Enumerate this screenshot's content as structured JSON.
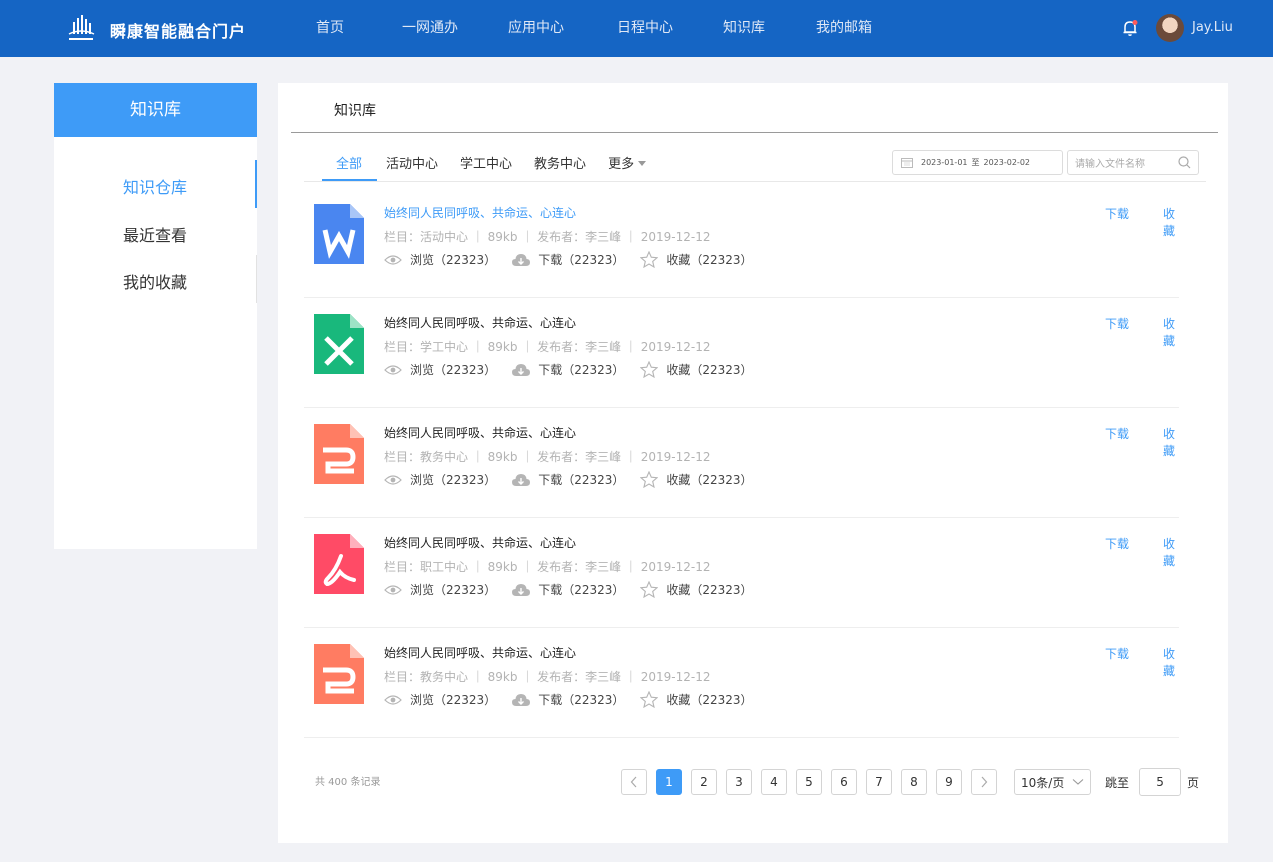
{
  "header": {
    "brand": "瞬康智能融合门户",
    "nav": [
      "首页",
      "一网通办",
      "应用中心",
      "日程中心",
      "知识库",
      "我的邮箱"
    ],
    "username": "Jay.Liu"
  },
  "sidebar": {
    "title": "知识库",
    "items": [
      {
        "label": "知识仓库",
        "active": true
      },
      {
        "label": "最近查看",
        "active": false
      },
      {
        "label": "我的收藏",
        "active": false
      }
    ]
  },
  "main": {
    "title": "知识库",
    "tabs": [
      "全部",
      "活动中心",
      "学工中心",
      "教务中心",
      "更多"
    ],
    "date_start": "2023-01-01",
    "date_sep": "至",
    "date_end": "2023-02-02",
    "search_placeholder": "请输入文件名称",
    "items": [
      {
        "icon": "word-file-icon",
        "title": "始终同人民同呼吸、共命运、心连心",
        "meta": "栏目：活动中心 ｜ 89kb ｜ 发布者：李三峰 ｜ 2019-12-12",
        "views": "浏览（22323）",
        "downloads": "下载（22323）",
        "favorites": "收藏（22323）"
      },
      {
        "icon": "excel-file-icon",
        "title": "始终同人民同呼吸、共命运、心连心",
        "meta": "栏目：学工中心 ｜ 89kb ｜ 发布者：李三峰 ｜ 2019-12-12",
        "views": "浏览（22323）",
        "downloads": "下载（22323）",
        "favorites": "收藏（22323）"
      },
      {
        "icon": "ppt-file-icon",
        "title": "始终同人民同呼吸、共命运、心连心",
        "meta": "栏目：教务中心 ｜ 89kb ｜ 发布者：李三峰 ｜ 2019-12-12",
        "views": "浏览（22323）",
        "downloads": "下载（22323）",
        "favorites": "收藏（22323）"
      },
      {
        "icon": "pdf-file-icon",
        "title": "始终同人民同呼吸、共命运、心连心",
        "meta": "栏目：职工中心 ｜ 89kb ｜ 发布者：李三峰 ｜ 2019-12-12",
        "views": "浏览（22323）",
        "downloads": "下载（22323）",
        "favorites": "收藏（22323）"
      },
      {
        "icon": "ppt-file-icon",
        "title": "始终同人民同呼吸、共命运、心连心",
        "meta": "栏目：教务中心 ｜ 89kb ｜ 发布者：李三峰 ｜ 2019-12-12",
        "views": "浏览（22323）",
        "downloads": "下载（22323）",
        "favorites": "收藏（22323）"
      }
    ],
    "download_label": "下载",
    "favorite_label": "收藏"
  },
  "pagination": {
    "total": "共 400 条记录",
    "pages": [
      "1",
      "2",
      "3",
      "4",
      "5",
      "6",
      "7",
      "8",
      "9"
    ],
    "current": "1",
    "page_size": "10条/页",
    "jump_label": "跳至",
    "jump_value": "5",
    "page_suffix": "页"
  },
  "colors": {
    "header_bg": "#1565c4",
    "accent": "#3e9bf7",
    "word": "#4a86f0",
    "excel": "#19b87c",
    "ppt": "#ff7c62",
    "pdf": "#ff4b66"
  }
}
